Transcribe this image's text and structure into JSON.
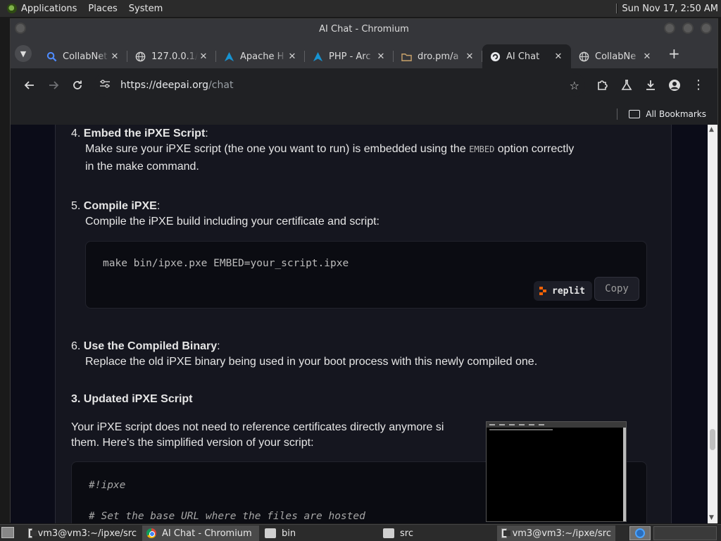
{
  "top_panel": {
    "menus": [
      "Applications",
      "Places",
      "System"
    ],
    "clock": "Sun Nov 17,  2:50 AM"
  },
  "window": {
    "title": "AI Chat - Chromium"
  },
  "tabs": [
    {
      "label": "CollabNet",
      "icon": "search-icon",
      "active": false
    },
    {
      "label": "127.0.0.1/",
      "icon": "globe-icon",
      "active": false
    },
    {
      "label": "Apache H",
      "icon": "arch-icon",
      "active": false
    },
    {
      "label": "PHP - Arc",
      "icon": "arch-icon",
      "active": false
    },
    {
      "label": "dro.pm/a",
      "icon": "folder-icon",
      "active": false
    },
    {
      "label": "AI Chat",
      "icon": "deepai-icon",
      "active": true
    },
    {
      "label": "CollabNe",
      "icon": "globe-icon",
      "active": false
    }
  ],
  "toolbar": {
    "url_host": "https://deepai.org",
    "url_path": "/chat"
  },
  "bookmarks": {
    "all_bookmarks_label": "All Bookmarks"
  },
  "content": {
    "step4_num": "4.",
    "step4_title": "Embed the iPXE Script",
    "step4_colon": ":",
    "step4_text_a": "Make sure your iPXE script (the one you want to run) is embedded using the",
    "step4_code": "EMBED",
    "step4_text_b": "option correctly",
    "step4_text_c": "in the make command.",
    "step5_num": "5.",
    "step5_title": "Compile iPXE",
    "step5_colon": ":",
    "step5_text": "Compile the iPXE build including your certificate and script:",
    "code1": "make bin/ipxe.pxe EMBED=your_script.ipxe",
    "replit_label": "replit",
    "copy_label": "Copy",
    "step6_num": "6.",
    "step6_title": "Use the Compiled Binary",
    "step6_colon": ":",
    "step6_text": "Replace the old iPXE binary being used in your boot process with this newly compiled one.",
    "section3_heading": "3. Updated iPXE Script",
    "para_a": "Your iPXE script does not need to reference certificates directly anymore si",
    "para_b": "them. Here's the simplified version of your script:",
    "code2_line1": "#!ipxe",
    "code2_line2": "# Set the base URL where the files are hosted"
  },
  "taskbar": {
    "tasks": [
      {
        "label": "vm3@vm3:~/ipxe/src",
        "icon": "terminal-icon"
      },
      {
        "label": "AI Chat - Chromium",
        "icon": "chromium-icon"
      },
      {
        "label": "bin",
        "icon": "folder-icon"
      },
      {
        "label": "src",
        "icon": "folder-icon"
      },
      {
        "label": "vm3@vm3:~/ipxe/src",
        "icon": "terminal-icon"
      }
    ]
  }
}
